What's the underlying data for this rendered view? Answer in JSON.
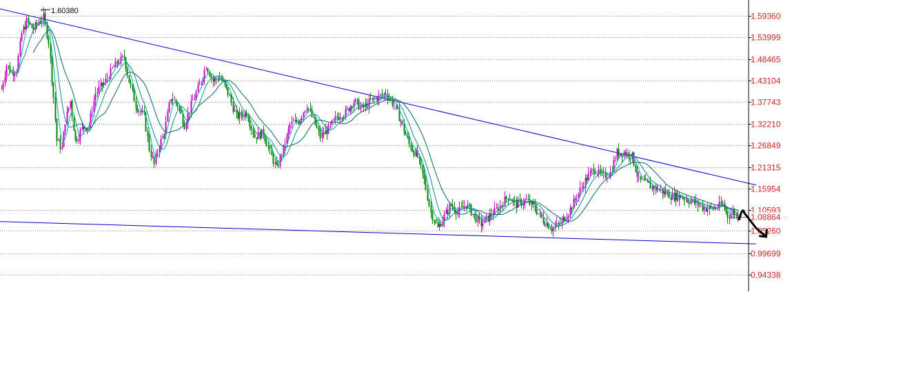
{
  "chart_data": {
    "type": "candlestick",
    "title": "",
    "xlabel": "",
    "ylabel": "",
    "ylim": [
      0.915,
      1.622
    ],
    "y_ticks": [
      "1.59360",
      "1.53999",
      "1.48465",
      "1.43104",
      "1.37743",
      "1.32210",
      "1.26849",
      "1.21315",
      "1.15954",
      "1.10593",
      "1.05260",
      "0.99699",
      "0.94338"
    ],
    "current_price_label": "1.08864",
    "current_price": 1.08864,
    "peak_annotation": {
      "text": "1.60380",
      "value": 1.6038,
      "bar_index": 24
    },
    "bar_count": 440,
    "grid": true,
    "legend": "none",
    "colors": {
      "axis_labels": "#cc2222",
      "grid": "#888888",
      "trendline": "#0000cc",
      "up_candle": "#cc00cc",
      "down_candle": "#008800",
      "ma_fast": "#00aaaa",
      "ma_mid": "#118888",
      "ma_slow": "#006666",
      "forecast_arrow": "#000000"
    },
    "trendlines": [
      {
        "name": "upper",
        "from": {
          "bar": -15,
          "value": 1.625
        },
        "to": {
          "bar": 450,
          "value": 1.168
        }
      },
      {
        "name": "lower",
        "from": {
          "bar": -15,
          "value": 1.078
        },
        "to": {
          "bar": 450,
          "value": 1.02
        }
      }
    ],
    "moving_averages": [
      5,
      10,
      20
    ],
    "price_path_anchors": [
      {
        "bar": 0,
        "value": 1.41
      },
      {
        "bar": 3,
        "value": 1.47
      },
      {
        "bar": 6,
        "value": 1.45
      },
      {
        "bar": 9,
        "value": 1.46
      },
      {
        "bar": 12,
        "value": 1.55
      },
      {
        "bar": 15,
        "value": 1.58
      },
      {
        "bar": 19,
        "value": 1.56
      },
      {
        "bar": 22,
        "value": 1.58
      },
      {
        "bar": 25,
        "value": 1.59
      },
      {
        "bar": 28,
        "value": 1.53
      },
      {
        "bar": 31,
        "value": 1.39
      },
      {
        "bar": 33,
        "value": 1.28
      },
      {
        "bar": 36,
        "value": 1.26
      },
      {
        "bar": 38,
        "value": 1.33
      },
      {
        "bar": 41,
        "value": 1.38
      },
      {
        "bar": 44,
        "value": 1.28
      },
      {
        "bar": 48,
        "value": 1.31
      },
      {
        "bar": 52,
        "value": 1.32
      },
      {
        "bar": 56,
        "value": 1.4
      },
      {
        "bar": 62,
        "value": 1.43
      },
      {
        "bar": 66,
        "value": 1.46
      },
      {
        "bar": 70,
        "value": 1.48
      },
      {
        "bar": 73,
        "value": 1.49
      },
      {
        "bar": 76,
        "value": 1.43
      },
      {
        "bar": 80,
        "value": 1.37
      },
      {
        "bar": 85,
        "value": 1.34
      },
      {
        "bar": 88,
        "value": 1.26
      },
      {
        "bar": 91,
        "value": 1.22
      },
      {
        "bar": 94,
        "value": 1.27
      },
      {
        "bar": 97,
        "value": 1.3
      },
      {
        "bar": 101,
        "value": 1.39
      },
      {
        "bar": 105,
        "value": 1.37
      },
      {
        "bar": 109,
        "value": 1.32
      },
      {
        "bar": 113,
        "value": 1.37
      },
      {
        "bar": 118,
        "value": 1.42
      },
      {
        "bar": 122,
        "value": 1.47
      },
      {
        "bar": 126,
        "value": 1.43
      },
      {
        "bar": 130,
        "value": 1.44
      },
      {
        "bar": 135,
        "value": 1.4
      },
      {
        "bar": 140,
        "value": 1.34
      },
      {
        "bar": 146,
        "value": 1.35
      },
      {
        "bar": 151,
        "value": 1.29
      },
      {
        "bar": 156,
        "value": 1.3
      },
      {
        "bar": 160,
        "value": 1.25
      },
      {
        "bar": 164,
        "value": 1.21
      },
      {
        "bar": 168,
        "value": 1.26
      },
      {
        "bar": 172,
        "value": 1.32
      },
      {
        "bar": 177,
        "value": 1.33
      },
      {
        "bar": 182,
        "value": 1.37
      },
      {
        "bar": 186,
        "value": 1.33
      },
      {
        "bar": 190,
        "value": 1.29
      },
      {
        "bar": 195,
        "value": 1.31
      },
      {
        "bar": 200,
        "value": 1.34
      },
      {
        "bar": 205,
        "value": 1.35
      },
      {
        "bar": 210,
        "value": 1.38
      },
      {
        "bar": 215,
        "value": 1.36
      },
      {
        "bar": 220,
        "value": 1.38
      },
      {
        "bar": 225,
        "value": 1.39
      },
      {
        "bar": 229,
        "value": 1.4
      },
      {
        "bar": 234,
        "value": 1.37
      },
      {
        "bar": 238,
        "value": 1.33
      },
      {
        "bar": 243,
        "value": 1.27
      },
      {
        "bar": 248,
        "value": 1.24
      },
      {
        "bar": 252,
        "value": 1.18
      },
      {
        "bar": 256,
        "value": 1.1
      },
      {
        "bar": 260,
        "value": 1.06
      },
      {
        "bar": 264,
        "value": 1.09
      },
      {
        "bar": 268,
        "value": 1.12
      },
      {
        "bar": 272,
        "value": 1.1
      },
      {
        "bar": 277,
        "value": 1.12
      },
      {
        "bar": 282,
        "value": 1.09
      },
      {
        "bar": 286,
        "value": 1.07
      },
      {
        "bar": 291,
        "value": 1.09
      },
      {
        "bar": 296,
        "value": 1.11
      },
      {
        "bar": 302,
        "value": 1.14
      },
      {
        "bar": 307,
        "value": 1.12
      },
      {
        "bar": 313,
        "value": 1.13
      },
      {
        "bar": 318,
        "value": 1.11
      },
      {
        "bar": 323,
        "value": 1.08
      },
      {
        "bar": 328,
        "value": 1.06
      },
      {
        "bar": 333,
        "value": 1.07
      },
      {
        "bar": 338,
        "value": 1.1
      },
      {
        "bar": 343,
        "value": 1.14
      },
      {
        "bar": 348,
        "value": 1.18
      },
      {
        "bar": 353,
        "value": 1.21
      },
      {
        "bar": 358,
        "value": 1.19
      },
      {
        "bar": 363,
        "value": 1.2
      },
      {
        "bar": 367,
        "value": 1.25
      },
      {
        "bar": 372,
        "value": 1.25
      },
      {
        "bar": 376,
        "value": 1.24
      },
      {
        "bar": 380,
        "value": 1.18
      },
      {
        "bar": 385,
        "value": 1.17
      },
      {
        "bar": 390,
        "value": 1.16
      },
      {
        "bar": 395,
        "value": 1.15
      },
      {
        "bar": 400,
        "value": 1.14
      },
      {
        "bar": 405,
        "value": 1.14
      },
      {
        "bar": 410,
        "value": 1.13
      },
      {
        "bar": 415,
        "value": 1.12
      },
      {
        "bar": 420,
        "value": 1.11
      },
      {
        "bar": 425,
        "value": 1.11
      },
      {
        "bar": 430,
        "value": 1.12
      },
      {
        "bar": 433,
        "value": 1.09
      },
      {
        "bar": 436,
        "value": 1.1
      },
      {
        "bar": 439,
        "value": 1.09
      }
    ],
    "forecast_path": [
      {
        "bar": 440,
        "value": 1.082
      },
      {
        "bar": 443,
        "value": 1.098
      },
      {
        "bar": 446,
        "value": 1.082
      },
      {
        "bar": 450,
        "value": 1.06
      },
      {
        "bar": 456,
        "value": 1.038
      }
    ]
  }
}
